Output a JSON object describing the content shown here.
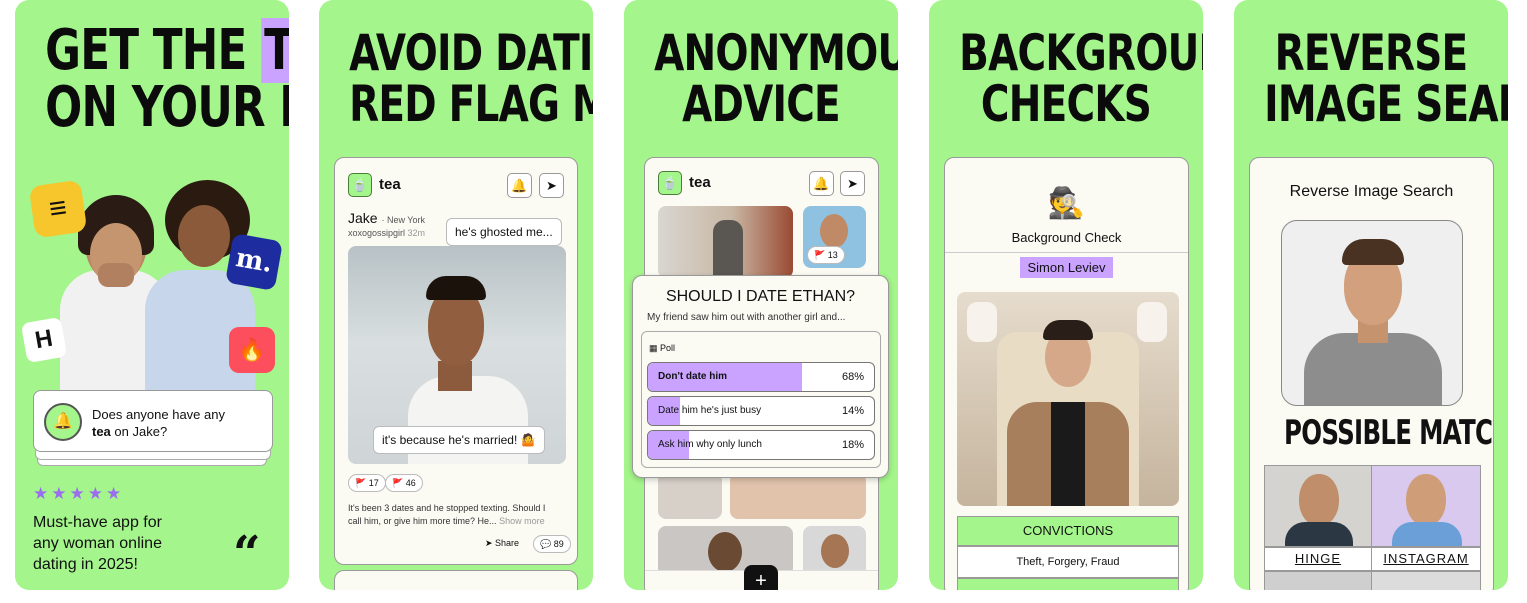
{
  "panels": [
    {
      "headline": [
        "GET THE ",
        "TEA",
        "ON YOUR DATE"
      ],
      "question": "Does anyone have any",
      "question_bold": "tea",
      "question_end": " on Jake?",
      "stars": [
        "★",
        "★",
        "★",
        "★",
        "★"
      ],
      "tagline": [
        "Must-have app for",
        "any woman online",
        "dating in 2025!"
      ],
      "quote_mark": "“",
      "badge_bumble": "≡",
      "badge_match": "m.",
      "badge_hinge": "H",
      "badge_tinder": "🔥"
    },
    {
      "headline": [
        "AVOID DATING",
        "RED FLAG MEN"
      ],
      "logo": "🍵",
      "logo_text": "tea",
      "bell_icon": "🔔",
      "send_icon": "➤",
      "post_name": "Jake",
      "post_location": "New York",
      "post_user": "xoxogossipgirl",
      "post_time": "32m",
      "bubble_top": "he's ghosted me...",
      "bubble_bottom": "it's because he's married! 🤷",
      "green_flags": "17",
      "red_flags": "46",
      "body": [
        "It's been 3 dates and he stopped texting. Should I",
        "call him, or give him more time? He..."
      ],
      "show_more": "Show more",
      "share_label": "Share",
      "comment_count": "89"
    },
    {
      "headline": [
        "ANONYMOUS",
        "ADVICE"
      ],
      "logo": "🍵",
      "logo_text": "tea",
      "bell_icon": "🔔",
      "send_icon": "➤",
      "thumb_flag_count": "13",
      "title": "SHOULD I DATE ETHAN?",
      "subtitle": "My friend saw him out with another girl and...",
      "poll_label": "Poll",
      "poll_options": [
        {
          "label": "Don't date him",
          "value": "68%",
          "fraction": 0.68
        },
        {
          "label": "Date him he's just busy",
          "value": "14%",
          "fraction": 0.14
        },
        {
          "label": "Ask him why only lunch",
          "value": "18%",
          "fraction": 0.18
        }
      ],
      "add_icon": "+"
    },
    {
      "headline": [
        "BACKGROUND",
        "CHECKS"
      ],
      "detective_icon": "🕵️",
      "card_title": "Background Check",
      "name": "Simon Leviev",
      "section_title": "CONVICTIONS",
      "convictions": "Theft, Forgery, Fraud"
    },
    {
      "headline": [
        "REVERSE",
        "IMAGE SEARCH"
      ],
      "card_title": "Reverse Image Search",
      "matches_title": "POSSIBLE MATCHES",
      "match_labels": [
        "HINGE",
        "INSTAGRAM"
      ]
    }
  ],
  "colors": {
    "panel_green": "#a4f58b",
    "accent_purple": "#c9a3ff",
    "card_bg": "#fbfaf3"
  }
}
